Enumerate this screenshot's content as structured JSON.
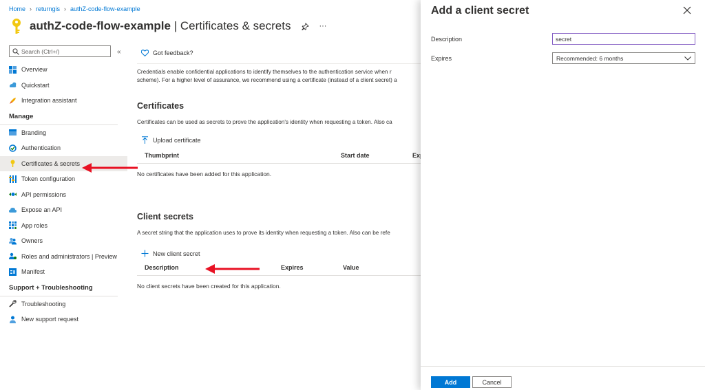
{
  "breadcrumb": [
    {
      "label": "Home"
    },
    {
      "label": "returngis"
    },
    {
      "label": "authZ-code-flow-example"
    }
  ],
  "header": {
    "app_name": "authZ-code-flow-example",
    "separator": " | ",
    "page_name": "Certificates & secrets",
    "more": "···"
  },
  "sidebar": {
    "search_placeholder": "Search (Ctrl+/)",
    "collapse": "«",
    "items_top": [
      {
        "label": "Overview",
        "icon": "overview-icon"
      },
      {
        "label": "Quickstart",
        "icon": "quickstart-icon"
      },
      {
        "label": "Integration assistant",
        "icon": "rocket-icon"
      }
    ],
    "manage_label": "Manage",
    "items_manage": [
      {
        "label": "Branding",
        "icon": "branding-icon"
      },
      {
        "label": "Authentication",
        "icon": "authentication-icon"
      },
      {
        "label": "Certificates & secrets",
        "icon": "key-icon"
      },
      {
        "label": "Token configuration",
        "icon": "token-config-icon"
      },
      {
        "label": "API permissions",
        "icon": "api-permissions-icon"
      },
      {
        "label": "Expose an API",
        "icon": "cloud-icon"
      },
      {
        "label": "App roles",
        "icon": "app-roles-icon"
      },
      {
        "label": "Owners",
        "icon": "owners-icon"
      },
      {
        "label": "Roles and administrators | Preview",
        "icon": "roles-icon"
      },
      {
        "label": "Manifest",
        "icon": "manifest-icon"
      }
    ],
    "support_label": "Support + Troubleshooting",
    "items_support": [
      {
        "label": "Troubleshooting",
        "icon": "wrench-icon"
      },
      {
        "label": "New support request",
        "icon": "support-person-icon"
      }
    ]
  },
  "main": {
    "feedback": "Got feedback?",
    "intro_line1": "Credentials enable confidential applications to identify themselves to the authentication service when r",
    "intro_line2": "scheme). For a higher level of assurance, we recommend using a certificate (instead of a client secret) a",
    "certificates": {
      "title": "Certificates",
      "desc": "Certificates can be used as secrets to prove the application's identity when requesting a token. Also ca",
      "upload": "Upload certificate",
      "col_thumbprint": "Thumbprint",
      "col_start": "Start date",
      "col_expires": "Exp",
      "empty": "No certificates have been added for this application."
    },
    "secrets": {
      "title": "Client secrets",
      "desc": "A secret string that the application uses to prove its identity when requesting a token. Also can be refe",
      "new": "New client secret",
      "col_description": "Description",
      "col_expires": "Expires",
      "col_value": "Value",
      "empty": "No client secrets have been created for this application."
    }
  },
  "panel": {
    "title": "Add a client secret",
    "description_label": "Description",
    "description_value": "secret",
    "expires_label": "Expires",
    "expires_value": "Recommended: 6 months",
    "add": "Add",
    "cancel": "Cancel"
  },
  "colors": {
    "accent": "#0078d4",
    "arrow": "#e81123",
    "active_bg": "#edebe9"
  }
}
